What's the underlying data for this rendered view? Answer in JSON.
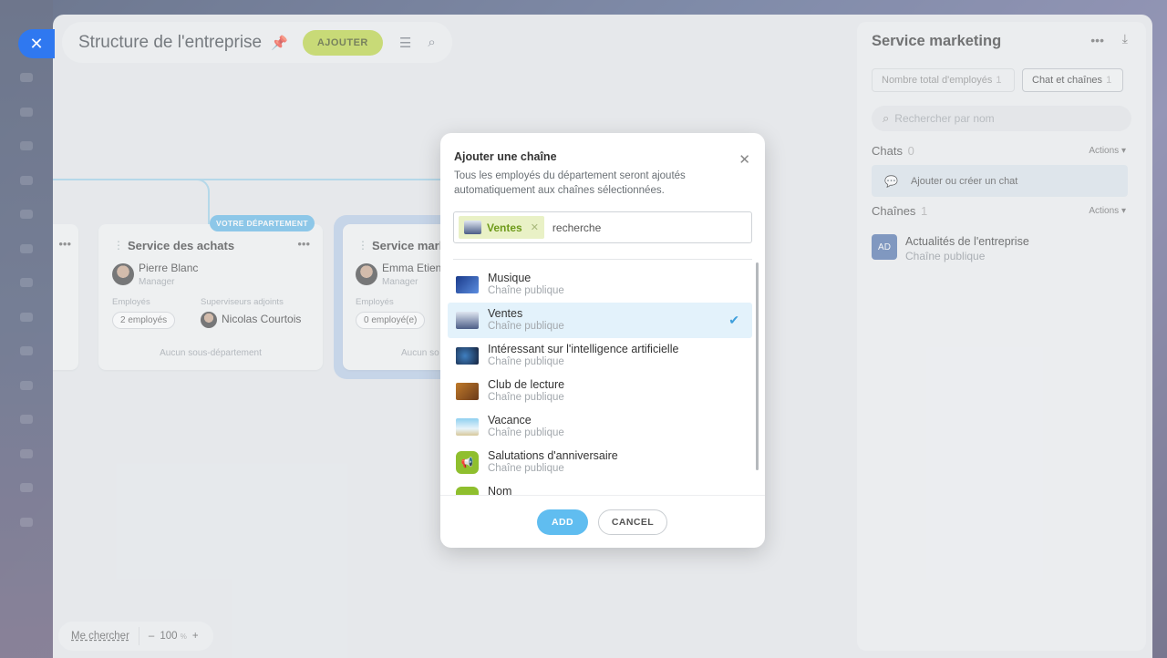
{
  "header": {
    "title": "Structure de l'entreprise",
    "add_label": "AJOUTER"
  },
  "cards": {
    "achats": {
      "title": "Service des achats",
      "badge": "VOTRE DÉPARTEMENT",
      "manager_name": "Pierre Blanc",
      "manager_role": "Manager",
      "employees_label": "Employés",
      "deputies_label": "Superviseurs adjoints",
      "employees_count": "2 employés",
      "deputy_name": "Nicolas Courtois",
      "no_sub": "Aucun sous-département"
    },
    "marketing": {
      "title": "Service mark",
      "manager_name": "Emma Etien",
      "manager_role": "Manager",
      "employees_label": "Employés",
      "employees_count": "0 employé(e)",
      "no_sub": "Aucun so"
    }
  },
  "zoom": {
    "find_me": "Me chercher",
    "minus": "–",
    "value": "100",
    "unit": "%",
    "plus": "+"
  },
  "right_panel": {
    "title": "Service marketing",
    "tab1_label": "Nombre total d'employés",
    "tab1_count": "1",
    "tab2_label": "Chat et chaînes",
    "tab2_count": "1",
    "search_placeholder": "Rechercher par nom",
    "chats_label": "Chats",
    "chats_count": "0",
    "actions_label": "Actions",
    "add_chat_label": "Ajouter ou créer un chat",
    "channels_label": "Chaînes",
    "channels_count": "1",
    "channel_initials": "AD",
    "channel_name": "Actualités de l'entreprise",
    "channel_sub": "Chaîne publique"
  },
  "modal": {
    "title": "Ajouter une chaîne",
    "description": "Tous les employés du département seront ajoutés automatiquement aux chaînes sélectionnées.",
    "tag_label": "Ventes",
    "search_value": "recherche",
    "items": [
      {
        "name": "Musique",
        "sub": "Chaîne publique"
      },
      {
        "name": "Ventes",
        "sub": "Chaîne publique"
      },
      {
        "name": "Intéressant sur l'intelligence artificielle",
        "sub": "Chaîne publique"
      },
      {
        "name": "Club de lecture",
        "sub": "Chaîne publique"
      },
      {
        "name": "Vacance",
        "sub": "Chaîne publique"
      },
      {
        "name": "Salutations d'anniversaire",
        "sub": "Chaîne publique"
      },
      {
        "name": "Nom",
        "sub": ""
      }
    ],
    "add_label": "ADD",
    "cancel_label": "CANCEL"
  }
}
